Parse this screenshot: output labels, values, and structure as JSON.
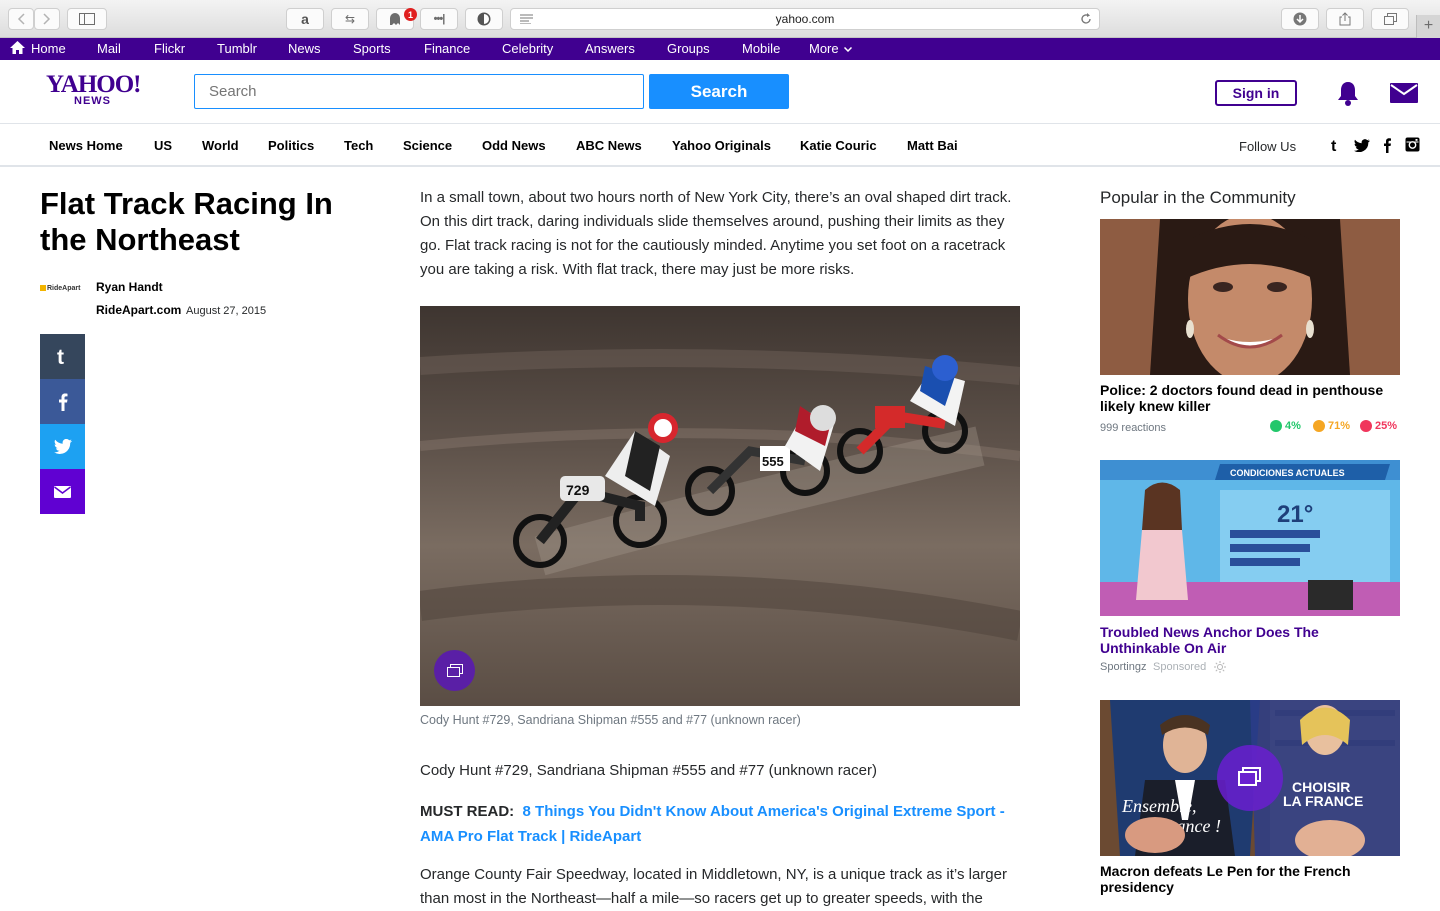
{
  "browser": {
    "url": "yahoo.com",
    "badge_count": "1"
  },
  "topnav": {
    "items": [
      "Home",
      "Mail",
      "Flickr",
      "Tumblr",
      "News",
      "Sports",
      "Finance",
      "Celebrity",
      "Answers",
      "Groups",
      "Mobile",
      "More"
    ]
  },
  "header": {
    "logo_main": "YAHOO!",
    "logo_sub": "NEWS",
    "search_placeholder": "Search",
    "search_button": "Search",
    "signin": "Sign in"
  },
  "secnav": {
    "items": [
      "News Home",
      "US",
      "World",
      "Politics",
      "Tech",
      "Science",
      "Odd News",
      "ABC News",
      "Yahoo Originals",
      "Katie Couric",
      "Matt Bai"
    ],
    "follow_label": "Follow Us"
  },
  "article": {
    "title": "Flat Track Racing In the Northeast",
    "provider_logo": "RideApart",
    "author": "Ryan Handt",
    "source": "RideApart.com",
    "date": "August 27, 2015",
    "intro": "In a small town, about two hours north of New York City, there’s an oval shaped dirt track. On this dirt track, daring individuals slide themselves around, pushing their limits as they go. Flat track racing is not for the cautiously minded. Anytime you set foot on a racetrack you are taking a risk. With flat track, there may just be more risks.",
    "image_caption": "Cody Hunt #729, Sandriana Shipman #555 and #77 (unknown racer)",
    "para2": "Cody Hunt #729, Sandriana Shipman #555 and #77 (unknown racer)",
    "must_read_label": "MUST READ:",
    "must_read_link": "8 Things You Didn't Know About America's Original Extreme Sport - AMA Pro Flat Track | RideApart",
    "para3": "Orange County Fair Speedway, located in Middletown, NY, is a unique track as it’s larger than most in the Northeast—half a mile—so racers get up to greater speeds, with the"
  },
  "sidebar": {
    "title": "Popular in the Community",
    "cards": [
      {
        "title": "Police: 2 doctors found dead in penthouse likely knew killer",
        "reactions": "999 reactions",
        "happy": "4%",
        "neutral": "71%",
        "sad": "25%"
      },
      {
        "title": "Troubled News Anchor Does The Unthinkable On Air",
        "sponsor": "Sportingz",
        "sponsored_label": "Sponsored",
        "overlay_header": "CONDICIONES ACTUALES",
        "overlay_temp": "21°"
      },
      {
        "title": "Macron defeats Le Pen for the French presidency",
        "overlay_right": "CHOISIR LA FRANCE",
        "overlay_left": "Ensemble, la France !"
      }
    ]
  },
  "colors": {
    "purple": "#400090",
    "blue": "#188fff",
    "happy": "#22c76b",
    "neutral": "#f5a623",
    "sad": "#f0365c"
  }
}
